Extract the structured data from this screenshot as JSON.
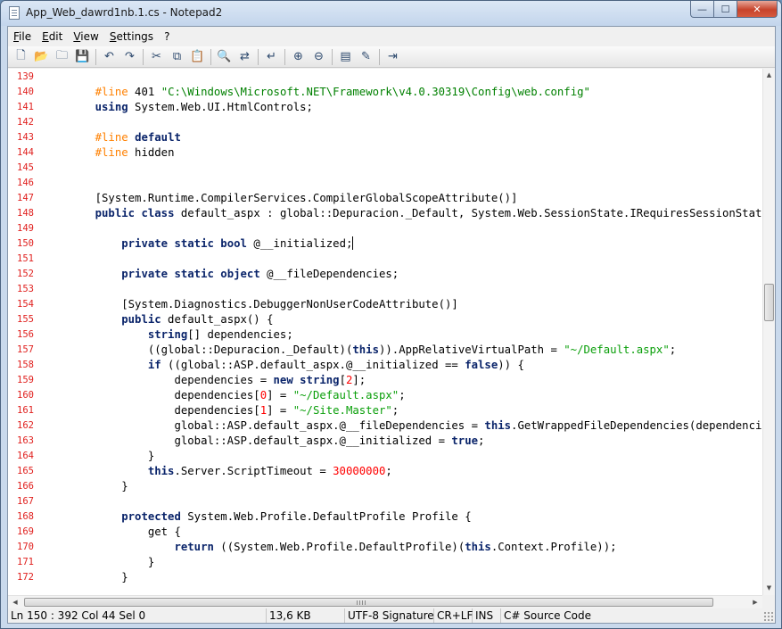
{
  "window": {
    "title": "App_Web_dawrd1nb.1.cs - Notepad2",
    "controls": {
      "minimize": "—",
      "maximize": "☐",
      "close": "✕"
    }
  },
  "menu": [
    "File",
    "Edit",
    "View",
    "Settings",
    "?"
  ],
  "toolbar": [
    {
      "name": "new-file-icon",
      "glyph": "🗋"
    },
    {
      "name": "open-file-icon",
      "glyph": "📂"
    },
    {
      "name": "browse-icon",
      "glyph": "🗀"
    },
    {
      "name": "save-icon",
      "glyph": "💾"
    },
    {
      "sep": true
    },
    {
      "name": "undo-icon",
      "glyph": "↶"
    },
    {
      "name": "redo-icon",
      "glyph": "↷"
    },
    {
      "sep": true
    },
    {
      "name": "cut-icon",
      "glyph": "✂"
    },
    {
      "name": "copy-icon",
      "glyph": "⧉"
    },
    {
      "name": "paste-icon",
      "glyph": "📋"
    },
    {
      "sep": true
    },
    {
      "name": "find-icon",
      "glyph": "🔍"
    },
    {
      "name": "replace-icon",
      "glyph": "⇄"
    },
    {
      "sep": true
    },
    {
      "name": "word-wrap-icon",
      "glyph": "↵"
    },
    {
      "sep": true
    },
    {
      "name": "zoom-in-icon",
      "glyph": "⊕"
    },
    {
      "name": "zoom-out-icon",
      "glyph": "⊖"
    },
    {
      "sep": true
    },
    {
      "name": "scheme-icon",
      "glyph": "▤"
    },
    {
      "name": "customize-scheme-icon",
      "glyph": "✎"
    },
    {
      "sep": true
    },
    {
      "name": "exit-icon",
      "glyph": "⇥"
    }
  ],
  "editor": {
    "lines": [
      {
        "n": "139",
        "t": []
      },
      {
        "n": "140",
        "t": [
          [
            "    ",
            "pl"
          ],
          [
            "#line",
            "pp"
          ],
          [
            " 401 ",
            "pl"
          ],
          [
            "\"C:\\Windows\\Microsoft.NET\\Framework\\v4.0.30319\\Config\\web.config\"",
            "str"
          ]
        ]
      },
      {
        "n": "141",
        "t": [
          [
            "    ",
            "pl"
          ],
          [
            "using",
            "kw"
          ],
          [
            " System.Web.UI.HtmlControls;",
            "pl"
          ]
        ]
      },
      {
        "n": "142",
        "t": []
      },
      {
        "n": "143",
        "t": [
          [
            "    ",
            "pl"
          ],
          [
            "#line",
            "pp"
          ],
          [
            " ",
            "pl"
          ],
          [
            "default",
            "kw"
          ]
        ]
      },
      {
        "n": "144",
        "t": [
          [
            "    ",
            "pl"
          ],
          [
            "#line",
            "pp"
          ],
          [
            " hidden",
            "pl"
          ]
        ]
      },
      {
        "n": "145",
        "t": []
      },
      {
        "n": "146",
        "t": []
      },
      {
        "n": "147",
        "t": [
          [
            "    [System.Runtime.CompilerServices.CompilerGlobalScopeAttribute()]",
            "pl"
          ]
        ]
      },
      {
        "n": "148",
        "t": [
          [
            "    ",
            "pl"
          ],
          [
            "public",
            "kw"
          ],
          [
            " ",
            "pl"
          ],
          [
            "class",
            "kw"
          ],
          [
            " default_aspx : global::Depuracion._Default, System.Web.SessionState.IRequiresSessionState",
            "pl"
          ]
        ]
      },
      {
        "n": "149",
        "t": []
      },
      {
        "n": "150",
        "t": [
          [
            "        ",
            "pl"
          ],
          [
            "private",
            "kw"
          ],
          [
            " ",
            "pl"
          ],
          [
            "static",
            "kw"
          ],
          [
            " ",
            "pl"
          ],
          [
            "bool",
            "kw"
          ],
          [
            " @__initialized;",
            "pl"
          ]
        ],
        "caret": true
      },
      {
        "n": "151",
        "t": []
      },
      {
        "n": "152",
        "t": [
          [
            "        ",
            "pl"
          ],
          [
            "private",
            "kw"
          ],
          [
            " ",
            "pl"
          ],
          [
            "static",
            "kw"
          ],
          [
            " ",
            "pl"
          ],
          [
            "object",
            "kw"
          ],
          [
            " @__fileDependencies;",
            "pl"
          ]
        ]
      },
      {
        "n": "153",
        "t": []
      },
      {
        "n": "154",
        "t": [
          [
            "        [System.Diagnostics.DebuggerNonUserCodeAttribute()]",
            "pl"
          ]
        ]
      },
      {
        "n": "155",
        "t": [
          [
            "        ",
            "pl"
          ],
          [
            "public",
            "kw"
          ],
          [
            " default_aspx() {",
            "pl"
          ]
        ]
      },
      {
        "n": "156",
        "t": [
          [
            "            ",
            "pl"
          ],
          [
            "string",
            "kw"
          ],
          [
            "[] dependencies;",
            "pl"
          ]
        ]
      },
      {
        "n": "157",
        "t": [
          [
            "            ((global::Depuracion._Default)(",
            "pl"
          ],
          [
            "this",
            "kw"
          ],
          [
            ")).AppRelativeVirtualPath = ",
            "pl"
          ],
          [
            "\"~/Default.aspx\"",
            "str2"
          ],
          [
            ";",
            "pl"
          ]
        ]
      },
      {
        "n": "158",
        "t": [
          [
            "            ",
            "pl"
          ],
          [
            "if",
            "kw"
          ],
          [
            " ((global::ASP.default_aspx.@__initialized == ",
            "pl"
          ],
          [
            "false",
            "kw"
          ],
          [
            ")) {",
            "pl"
          ]
        ]
      },
      {
        "n": "159",
        "t": [
          [
            "                dependencies = ",
            "pl"
          ],
          [
            "new",
            "kw"
          ],
          [
            " ",
            "pl"
          ],
          [
            "string",
            "kw"
          ],
          [
            "[",
            "pl"
          ],
          [
            "2",
            "num"
          ],
          [
            "];",
            "pl"
          ]
        ]
      },
      {
        "n": "160",
        "t": [
          [
            "                dependencies[",
            "pl"
          ],
          [
            "0",
            "num"
          ],
          [
            "] = ",
            "pl"
          ],
          [
            "\"~/Default.aspx\"",
            "str2"
          ],
          [
            ";",
            "pl"
          ]
        ]
      },
      {
        "n": "161",
        "t": [
          [
            "                dependencies[",
            "pl"
          ],
          [
            "1",
            "num"
          ],
          [
            "] = ",
            "pl"
          ],
          [
            "\"~/Site.Master\"",
            "str2"
          ],
          [
            ";",
            "pl"
          ]
        ]
      },
      {
        "n": "162",
        "t": [
          [
            "                global::ASP.default_aspx.@__fileDependencies = ",
            "pl"
          ],
          [
            "this",
            "kw"
          ],
          [
            ".GetWrappedFileDependencies(dependencies);",
            "pl"
          ]
        ]
      },
      {
        "n": "163",
        "t": [
          [
            "                global::ASP.default_aspx.@__initialized = ",
            "pl"
          ],
          [
            "true",
            "kw"
          ],
          [
            ";",
            "pl"
          ]
        ]
      },
      {
        "n": "164",
        "t": [
          [
            "            }",
            "pl"
          ]
        ]
      },
      {
        "n": "165",
        "t": [
          [
            "            ",
            "pl"
          ],
          [
            "this",
            "kw"
          ],
          [
            ".Server.ScriptTimeout = ",
            "pl"
          ],
          [
            "30000000",
            "num"
          ],
          [
            ";",
            "pl"
          ]
        ]
      },
      {
        "n": "166",
        "t": [
          [
            "        }",
            "pl"
          ]
        ]
      },
      {
        "n": "167",
        "t": []
      },
      {
        "n": "168",
        "t": [
          [
            "        ",
            "pl"
          ],
          [
            "protected",
            "kw"
          ],
          [
            " System.Web.Profile.DefaultProfile Profile {",
            "pl"
          ]
        ]
      },
      {
        "n": "169",
        "t": [
          [
            "            get {",
            "pl"
          ]
        ]
      },
      {
        "n": "170",
        "t": [
          [
            "                ",
            "pl"
          ],
          [
            "return",
            "kw"
          ],
          [
            " ((System.Web.Profile.DefaultProfile)(",
            "pl"
          ],
          [
            "this",
            "kw"
          ],
          [
            ".Context.Profile));",
            "pl"
          ]
        ]
      },
      {
        "n": "171",
        "t": [
          [
            "            }",
            "pl"
          ]
        ]
      },
      {
        "n": "172",
        "t": [
          [
            "        }",
            "pl"
          ]
        ]
      }
    ]
  },
  "status": {
    "position": "Ln 150 : 392   Col 44   Sel 0",
    "size": "13,6 KB",
    "encoding": "UTF-8 Signature",
    "eol": "CR+LF",
    "ovr": "INS",
    "lexer": "C# Source Code"
  },
  "colors": {
    "keyword": "#0a246a",
    "preprocessor": "#ff8000",
    "string": "#008000",
    "number": "#ff0000",
    "line_number": "#e0211f"
  }
}
